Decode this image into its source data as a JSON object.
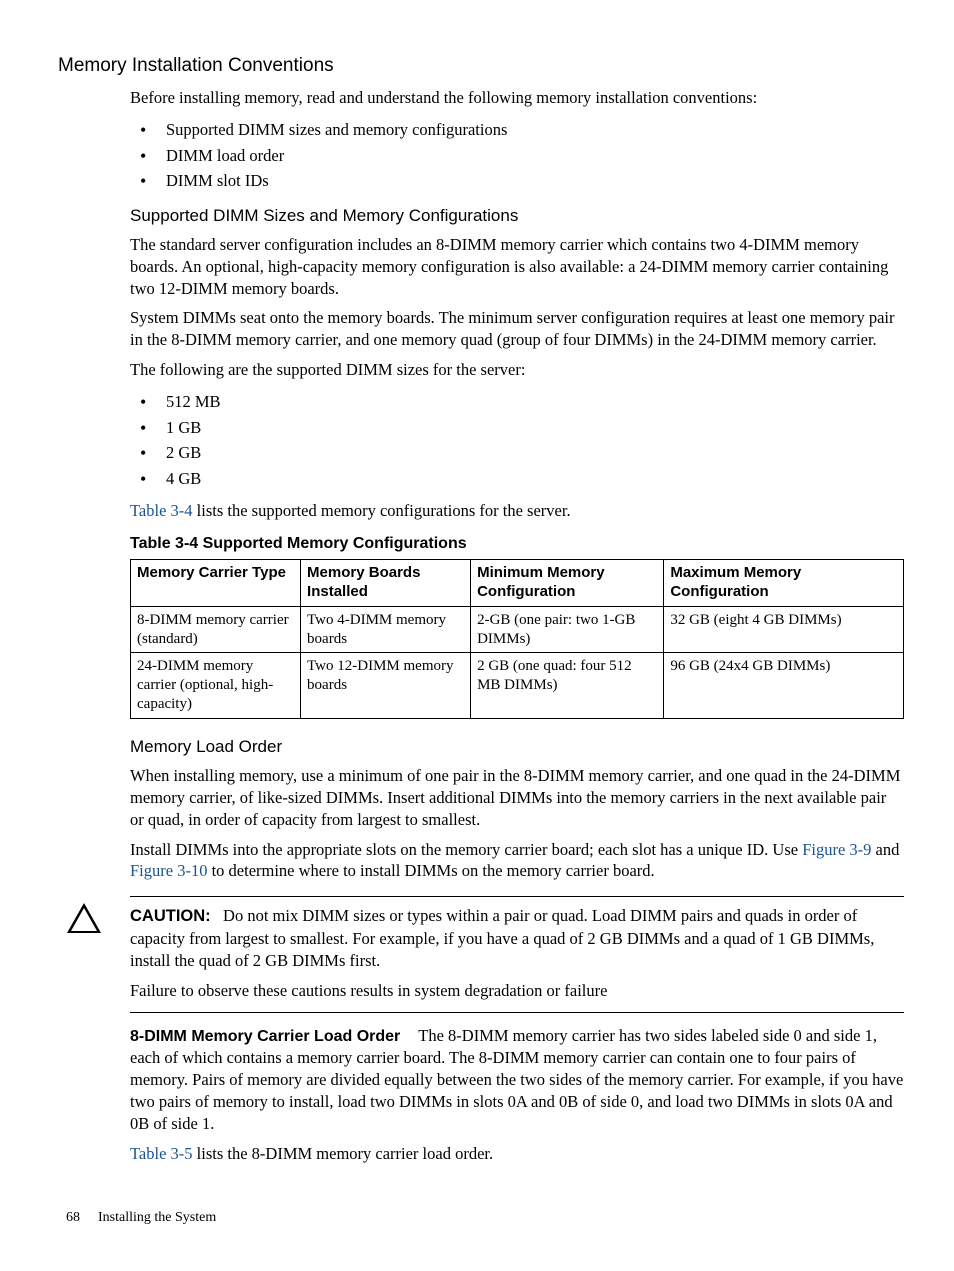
{
  "headings": {
    "h3": "Memory Installation Conventions",
    "h4a": "Supported DIMM Sizes and Memory Configurations",
    "h4b": "Memory Load Order"
  },
  "intro": {
    "p1": "Before installing memory, read and understand the following memory installation conventions:",
    "bullets": [
      "Supported DIMM sizes and memory configurations",
      "DIMM load order",
      "DIMM slot IDs"
    ]
  },
  "supported": {
    "p1": "The standard server configuration includes an 8-DIMM memory carrier which contains two 4-DIMM memory boards. An optional, high-capacity memory configuration is also available: a 24-DIMM memory carrier containing two 12-DIMM memory boards.",
    "p2": "System DIMMs seat onto the memory boards. The minimum server configuration requires at least one memory pair in the 8-DIMM memory carrier, and one memory quad (group of four DIMMs) in the 24-DIMM memory carrier.",
    "p3": "The following are the supported DIMM sizes for the server:",
    "sizes": [
      "512 MB",
      "1 GB",
      "2 GB",
      "4 GB"
    ],
    "p4_link": "Table 3-4",
    "p4_rest": " lists the supported memory configurations for the server."
  },
  "table": {
    "caption": "Table  3-4  Supported Memory Configurations",
    "headers": [
      "Memory Carrier Type",
      "Memory Boards Installed",
      "Minimum Memory Configuration",
      "Maximum Memory Configuration"
    ],
    "rows": [
      [
        "8-DIMM memory carrier (standard)",
        "Two 4-DIMM memory boards",
        "2-GB (one pair: two 1-GB DIMMs)",
        "32 GB (eight 4 GB DIMMs)"
      ],
      [
        "24-DIMM memory carrier (optional, high-capacity)",
        "Two 12-DIMM memory boards",
        "2 GB (one quad: four 512 MB DIMMs)",
        "96 GB (24x4 GB DIMMs)"
      ]
    ]
  },
  "load": {
    "p1": "When installing memory, use a minimum of one pair in the 8-DIMM memory carrier, and one quad in the 24-DIMM memory carrier, of like-sized DIMMs. Insert additional DIMMs into the memory carriers in the next available pair or quad, in order of capacity from largest to smallest.",
    "p2a": "Install DIMMs into the appropriate slots on the memory carrier board; each slot has a unique ID. Use ",
    "p2_link1": "Figure 3-9",
    "p2b": " and ",
    "p2_link2": "Figure 3-10",
    "p2c": " to determine where to install DIMMs on the memory carrier board."
  },
  "caution": {
    "label": "CAUTION:",
    "p1": "Do not mix DIMM sizes or types within a pair or quad. Load DIMM pairs and quads in order of capacity from largest to smallest. For example, if you have a quad of 2 GB DIMMs and a quad of 1 GB DIMMs, install the quad of 2 GB DIMMs first.",
    "p2": "Failure to observe these cautions results in system degradation or failure"
  },
  "eightdimm": {
    "inline_head": "8-DIMM Memory Carrier Load Order",
    "body": "The 8-DIMM memory carrier has two sides labeled side 0 and side 1, each of which contains a memory carrier board. The 8-DIMM memory carrier can contain one to four pairs of memory. Pairs of memory are divided equally between the two sides of the memory carrier. For example, if you have two pairs of memory to install, load two DIMMs in slots 0A and 0B of side 0, and load two DIMMs in slots 0A and 0B of side 1.",
    "p2_link": "Table 3-5",
    "p2_rest": " lists the 8-DIMM memory carrier load order."
  },
  "footer": {
    "page": "68",
    "title": "Installing the System"
  }
}
